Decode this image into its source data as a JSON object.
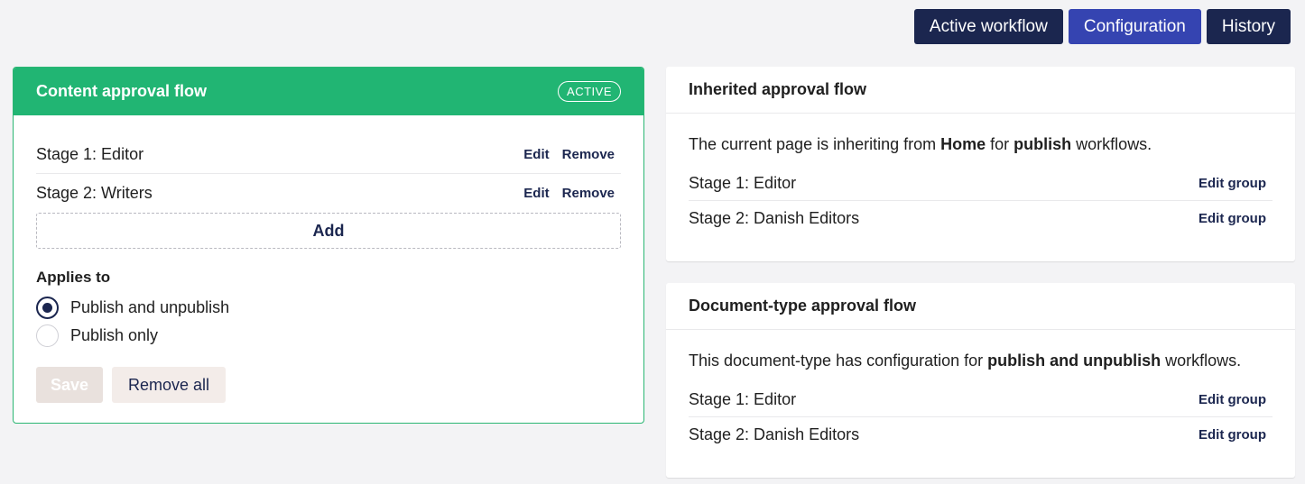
{
  "tabs": {
    "active_workflow": "Active workflow",
    "configuration": "Configuration",
    "history": "History"
  },
  "content_flow": {
    "title": "Content approval flow",
    "badge": "ACTIVE",
    "stages": [
      {
        "name": "Stage 1: Editor",
        "edit": "Edit",
        "remove": "Remove"
      },
      {
        "name": "Stage 2: Writers",
        "edit": "Edit",
        "remove": "Remove"
      }
    ],
    "add_label": "Add",
    "applies_to_label": "Applies to",
    "options": [
      {
        "label": "Publish and unpublish",
        "checked": true
      },
      {
        "label": "Publish only",
        "checked": false
      }
    ],
    "save_label": "Save",
    "remove_all_label": "Remove all"
  },
  "inherited_flow": {
    "title": "Inherited approval flow",
    "desc_prefix": "The current page is inheriting from ",
    "desc_source": "Home",
    "desc_middle": " for ",
    "desc_type": "publish",
    "desc_suffix": " workflows.",
    "stages": [
      {
        "name": "Stage 1: Editor",
        "action": "Edit group"
      },
      {
        "name": "Stage 2: Danish Editors",
        "action": "Edit group"
      }
    ]
  },
  "doctype_flow": {
    "title": "Document-type approval flow",
    "desc_prefix": "This document-type has configuration for ",
    "desc_type": "publish and unpublish",
    "desc_suffix": " workflows.",
    "stages": [
      {
        "name": "Stage 1: Editor",
        "action": "Edit group"
      },
      {
        "name": "Stage 2: Danish Editors",
        "action": "Edit group"
      }
    ]
  },
  "colors": {
    "header_green": "#21b573",
    "navy": "#1b264f",
    "selected_tab": "#3544b1"
  }
}
